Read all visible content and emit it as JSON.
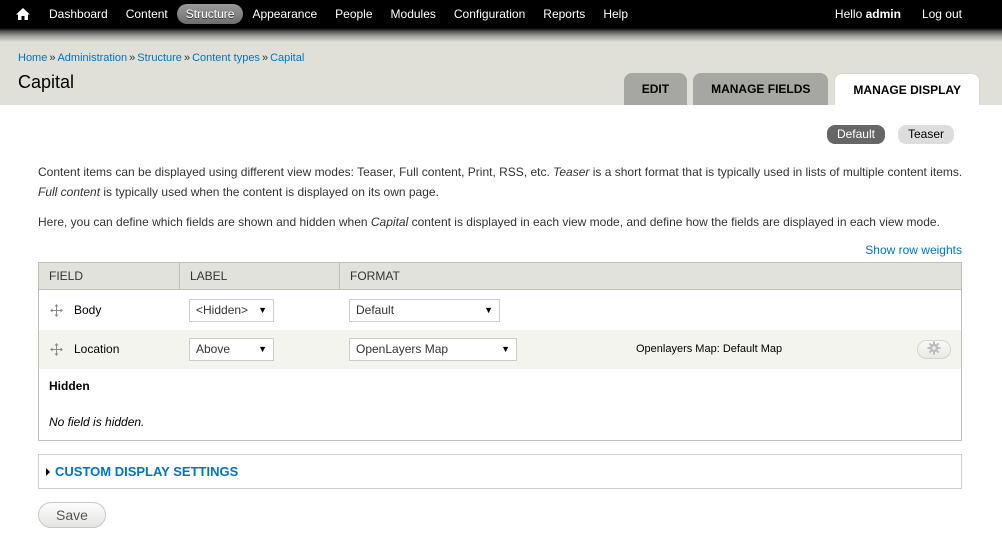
{
  "toolbar": {
    "home_icon": "home-icon",
    "menu": [
      {
        "label": "Dashboard",
        "active": false
      },
      {
        "label": "Content",
        "active": false
      },
      {
        "label": "Structure",
        "active": true
      },
      {
        "label": "Appearance",
        "active": false
      },
      {
        "label": "People",
        "active": false
      },
      {
        "label": "Modules",
        "active": false
      },
      {
        "label": "Configuration",
        "active": false
      },
      {
        "label": "Reports",
        "active": false
      },
      {
        "label": "Help",
        "active": false
      }
    ],
    "hello_prefix": "Hello ",
    "username": "admin",
    "logout_label": "Log out"
  },
  "breadcrumb": {
    "items": [
      "Home",
      "Administration",
      "Structure",
      "Content types",
      "Capital"
    ],
    "separator": "»"
  },
  "page_title": "Capital",
  "tabs": [
    {
      "label": "Edit",
      "active": false
    },
    {
      "label": "Manage fields",
      "active": false
    },
    {
      "label": "Manage display",
      "active": true
    }
  ],
  "view_modes": [
    {
      "label": "Default",
      "active": true
    },
    {
      "label": "Teaser",
      "active": false
    }
  ],
  "description": {
    "p1_a": "Content items can be displayed using different view modes: Teaser, Full content, Print, RSS, etc. ",
    "p1_em1": "Teaser",
    "p1_b": " is a short format that is typically used in lists of multiple content items. ",
    "p1_em2": "Full content",
    "p1_c": " is typically used when the content is displayed on its own page.",
    "p2_a": "Here, you can define which fields are shown and hidden when ",
    "p2_em": "Capital",
    "p2_b": " content is displayed in each view mode, and define how the fields are displayed in each view mode."
  },
  "show_row_weights": "Show row weights",
  "table": {
    "headers": [
      "Field",
      "Label",
      "Format"
    ],
    "rows": [
      {
        "field": "Body",
        "label": "<Hidden>",
        "format": "Default",
        "summary": ""
      },
      {
        "field": "Location",
        "label": "Above",
        "format": "OpenLayers Map",
        "summary": "Openlayers Map: Default Map"
      }
    ],
    "hidden_region_title": "Hidden",
    "hidden_region_empty": "No field is hidden."
  },
  "custom_display_settings": "Custom display settings",
  "save_label": "Save",
  "colors": {
    "link": "#0074bd",
    "toolbar_bg": "#000000",
    "header_bg": "#e0e0d8",
    "tab_inactive": "#a6a7a2",
    "view_mode_active": "#666666"
  }
}
